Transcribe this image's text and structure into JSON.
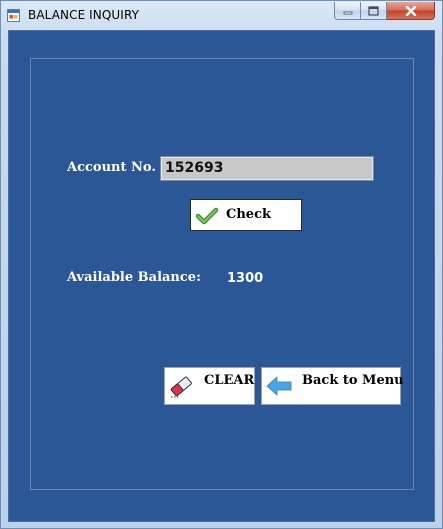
{
  "window": {
    "title": "BALANCE INQUIRY",
    "app_icon": "form-icon",
    "controls": {
      "minimize_icon": "minimize-icon",
      "maximize_icon": "maximize-icon",
      "close_icon": "close-icon"
    }
  },
  "form": {
    "account_label": "Account No.",
    "account_value": "152693",
    "check_button": {
      "label": "Check",
      "icon": "checkmark-icon"
    },
    "balance_label": "Available Balance:",
    "balance_value": "1300",
    "clear_button": {
      "label": "CLEAR",
      "icon": "eraser-icon"
    },
    "back_button": {
      "label": "Back to Menu",
      "icon": "left-arrow-icon"
    }
  },
  "colors": {
    "background": "#2b5797",
    "text": "#ffffff",
    "input_background": "#c8c8c8",
    "close_button": "#c0432a"
  }
}
